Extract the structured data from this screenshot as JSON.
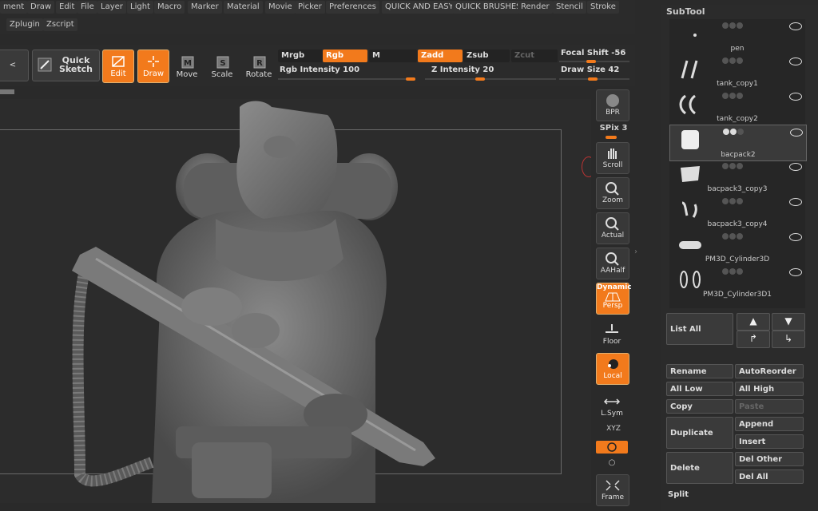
{
  "menus_row1": [
    "ment",
    "Draw",
    "Edit",
    "File",
    "Layer",
    "Light",
    "Macro",
    "Marker",
    "Material",
    "Movie",
    "Picker",
    "Preferences",
    "QUICK AND EASY",
    "QUICK BRUSHES",
    "Render",
    "Stencil",
    "Stroke"
  ],
  "menus_row2": [
    "Zplugin",
    "Zscript"
  ],
  "toolbar": {
    "back_glyph": "<",
    "quick_sketch_label_1": "Quick",
    "quick_sketch_label_2": "Sketch",
    "edit_label": "Edit",
    "draw_label": "Draw",
    "move_label": "Move",
    "scale_label": "Scale",
    "rotate_label": "Rotate",
    "mrgb": "Mrgb",
    "rgb": "Rgb",
    "m": "M",
    "zadd": "Zadd",
    "zsub": "Zsub",
    "zcut": "Zcut",
    "rgb_intensity": "Rgb Intensity 100",
    "z_intensity": "Z Intensity 20",
    "focal_shift": "Focal Shift -56",
    "draw_size": "Draw Size 42",
    "rgb_intensity_level": 1.0,
    "z_intensity_level": 0.2
  },
  "shelf": {
    "bpr": "BPR",
    "spix": "SPix 3",
    "scroll": "Scroll",
    "zoom": "Zoom",
    "actual": "Actual",
    "aahalf": "AAHalf",
    "dynamic": "Dynamic",
    "persp": "Persp",
    "floor": "Floor",
    "local": "Local",
    "lsym": "L.Sym",
    "xyz": "XYZ",
    "frame": "Frame"
  },
  "subtool": {
    "title": "SubTool",
    "items": [
      {
        "name": "pen",
        "selected": false
      },
      {
        "name": "tank_copy1",
        "selected": false
      },
      {
        "name": "tank_copy2",
        "selected": false
      },
      {
        "name": "bacpack2",
        "selected": true
      },
      {
        "name": "bacpack3_copy3",
        "selected": false
      },
      {
        "name": "bacpack3_copy4",
        "selected": false
      },
      {
        "name": "PM3D_Cylinder3D",
        "selected": false
      },
      {
        "name": "PM3D_Cylinder3D1",
        "selected": false
      }
    ],
    "list_all": "List All",
    "rename": "Rename",
    "autoreorder": "AutoReorder",
    "all_low": "All Low",
    "all_high": "All High",
    "copy": "Copy",
    "paste": "Paste",
    "duplicate": "Duplicate",
    "append": "Append",
    "insert": "Insert",
    "delete": "Delete",
    "del_other": "Del Other",
    "del_all": "Del All",
    "split": "Split"
  },
  "colors": {
    "accent": "#f27a1c",
    "background": "#2a2a2a",
    "model": "#6e6e6e"
  }
}
